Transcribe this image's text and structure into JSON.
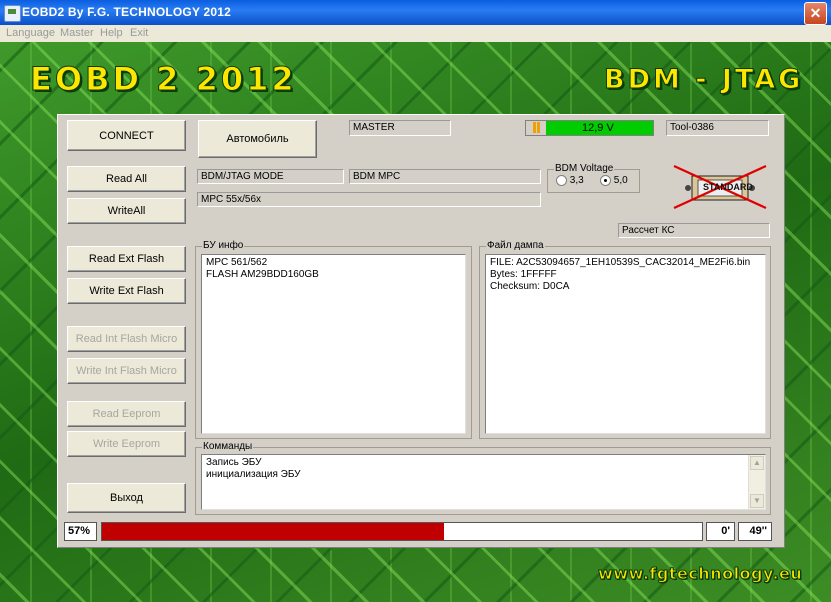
{
  "window": {
    "title": "EOBD2 By F.G. TECHNOLOGY 2012",
    "close_label": "✕"
  },
  "menu": [
    "Language",
    "Master",
    "Help",
    "Exit"
  ],
  "banner": {
    "left_logo": "EOBD 2 2012",
    "right_logo": "BDM - JTAG",
    "url": "www.fgtechnology.eu"
  },
  "buttons": {
    "connect": "CONNECT",
    "vehicle": "Автомобиль",
    "read_all": "Read All",
    "write_all": "WriteAll",
    "read_ext_flash": "Read Ext Flash",
    "write_ext_flash": "Write Ext Flash",
    "read_int_flash_micro": "Read Int Flash Micro",
    "write_int_flash_micro": "Write Int Flash Micro",
    "read_eeprom": "Read Eeprom",
    "write_eeprom": "Write Eeprom",
    "exit": "Выход",
    "checksum": "Рассчет КС"
  },
  "status": {
    "master": "MASTER",
    "voltage": "12,9 V",
    "tool": "Tool-0386",
    "mode": "BDM/JTAG  MODE",
    "protocol": "BDM MPC",
    "ecu_family": "MPC 55x/56x"
  },
  "bdm_voltage": {
    "label": "BDM Voltage",
    "options": [
      "3,3",
      "5,0"
    ],
    "selected": "5,0"
  },
  "stamp": {
    "text": "STANDARD"
  },
  "ecu_info": {
    "label": "БУ инфо",
    "lines": [
      "MPC 561/562",
      "FLASH AM29BDD160GB"
    ]
  },
  "dump_file": {
    "label": "Файл дампа",
    "lines": [
      "FILE: A2C53094657_1EH10539S_CAC32014_ME2Fi6.bin",
      "Bytes: 1FFFFF",
      "Checksum: D0CA"
    ]
  },
  "commands": {
    "label": "Комманды",
    "lines": [
      "Запись ЭБУ",
      "инициализация ЭБУ"
    ]
  },
  "progress": {
    "percent_label": "57%",
    "value": 0.57,
    "minutes": "0'",
    "seconds": "49''"
  },
  "colors": {
    "voltage_ok": "#00cc00",
    "progress_fill": "#c00000",
    "logo": "#ffe600"
  }
}
